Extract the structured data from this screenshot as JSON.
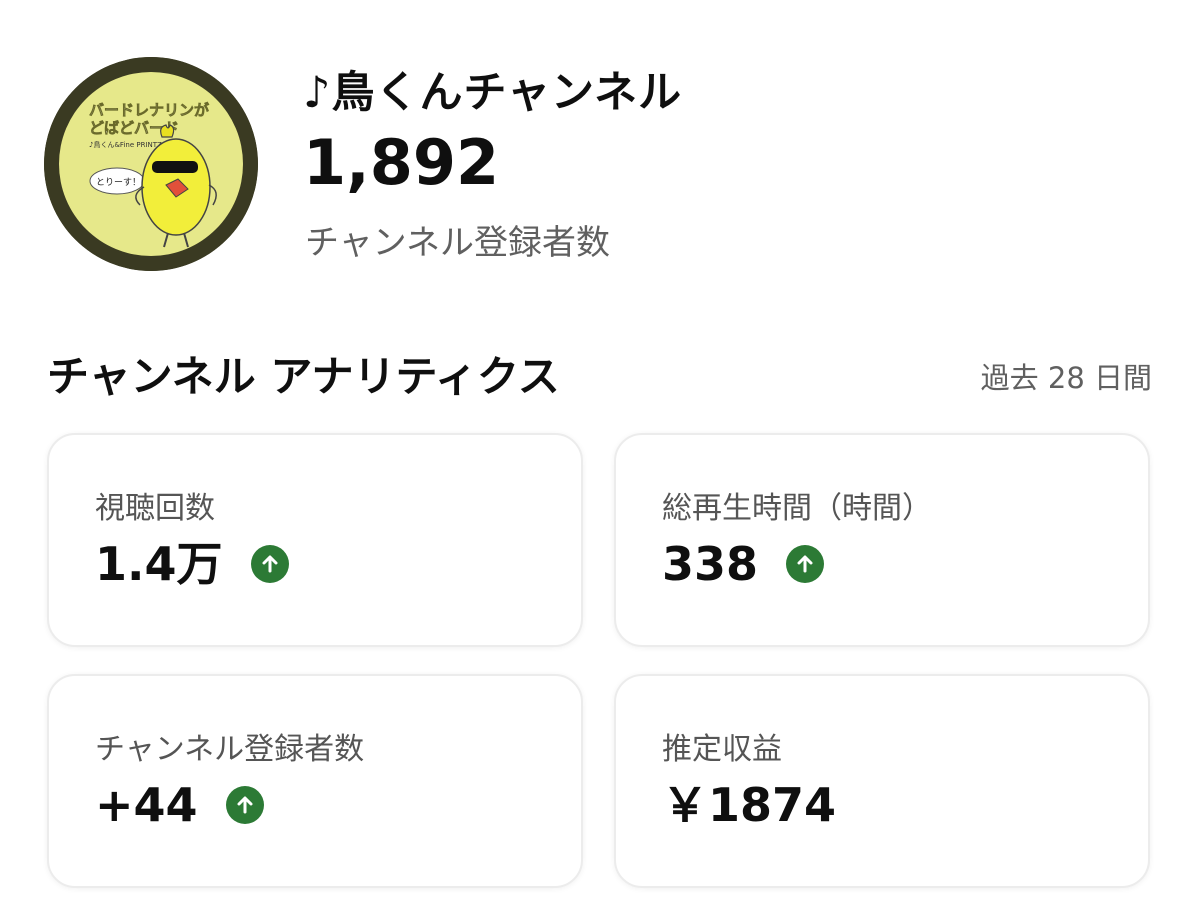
{
  "channel": {
    "name": "♪鳥くんチャンネル",
    "subscriber_count": "1,892",
    "subscriber_label": "チャンネル登録者数",
    "avatar": {
      "title_line1": "バードレナリンが",
      "title_line2": "どばどバード",
      "credit": "♪鳥くん&Fine PRINTZ",
      "speech": "とりーす！"
    }
  },
  "analytics": {
    "title": "チャンネル アナリティクス",
    "period": "過去 28 日間",
    "cards": [
      {
        "label": "視聴回数",
        "value": "1.4万",
        "trend": "up"
      },
      {
        "label": "総再生時間（時間）",
        "value": "338",
        "trend": "up"
      },
      {
        "label": "チャンネル登録者数",
        "value": "+44",
        "trend": "up"
      },
      {
        "label": "推定収益",
        "value": "￥1874",
        "trend": "none"
      }
    ]
  },
  "colors": {
    "trend_up": "#2c7a35",
    "avatar_bg": "#e6e88a",
    "avatar_ring": "#3a3a22"
  },
  "icons": {
    "trend": "arrow-up-circle-icon"
  }
}
